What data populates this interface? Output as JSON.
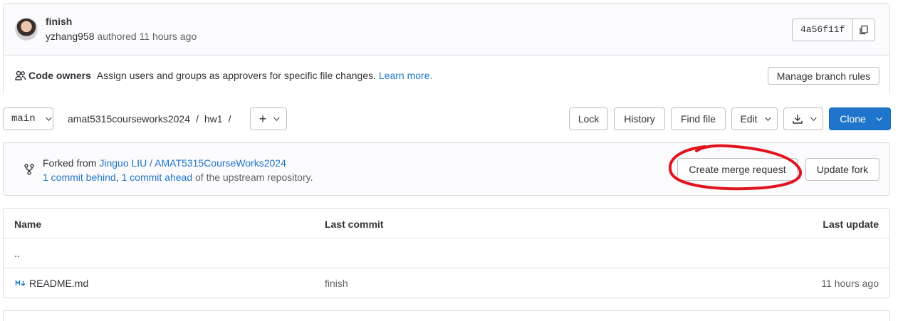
{
  "commit": {
    "title": "finish",
    "author": "yzhang958",
    "authored_text": "authored 11 hours ago",
    "sha": "4a56f11f"
  },
  "code_owners": {
    "label": "Code owners",
    "description": "Assign users and groups as approvers for specific file changes.",
    "learn_more": "Learn more.",
    "manage_button": "Manage branch rules"
  },
  "toolbar": {
    "branch": "main",
    "breadcrumb": [
      "amat5315courseworks2024",
      "/",
      "hw1",
      "/"
    ],
    "add_label": "+",
    "lock": "Lock",
    "history": "History",
    "find_file": "Find file",
    "edit": "Edit",
    "clone": "Clone"
  },
  "fork": {
    "forked_from_prefix": "Forked from",
    "upstream": "Jinguo LIU / AMAT5315CourseWorks2024",
    "behind": "1 commit behind",
    "comma": ",",
    "ahead": "1 commit ahead",
    "suffix": "of the upstream repository.",
    "create_mr": "Create merge request",
    "update_fork": "Update fork"
  },
  "files": {
    "columns": [
      "Name",
      "Last commit",
      "Last update"
    ],
    "parent": "..",
    "rows": [
      {
        "name": "README.md",
        "last_commit": "finish",
        "last_update": "11 hours ago",
        "icon": "markdown-icon"
      }
    ]
  },
  "colors": {
    "accent": "#1f75cb",
    "annotation": "#e0141e"
  }
}
